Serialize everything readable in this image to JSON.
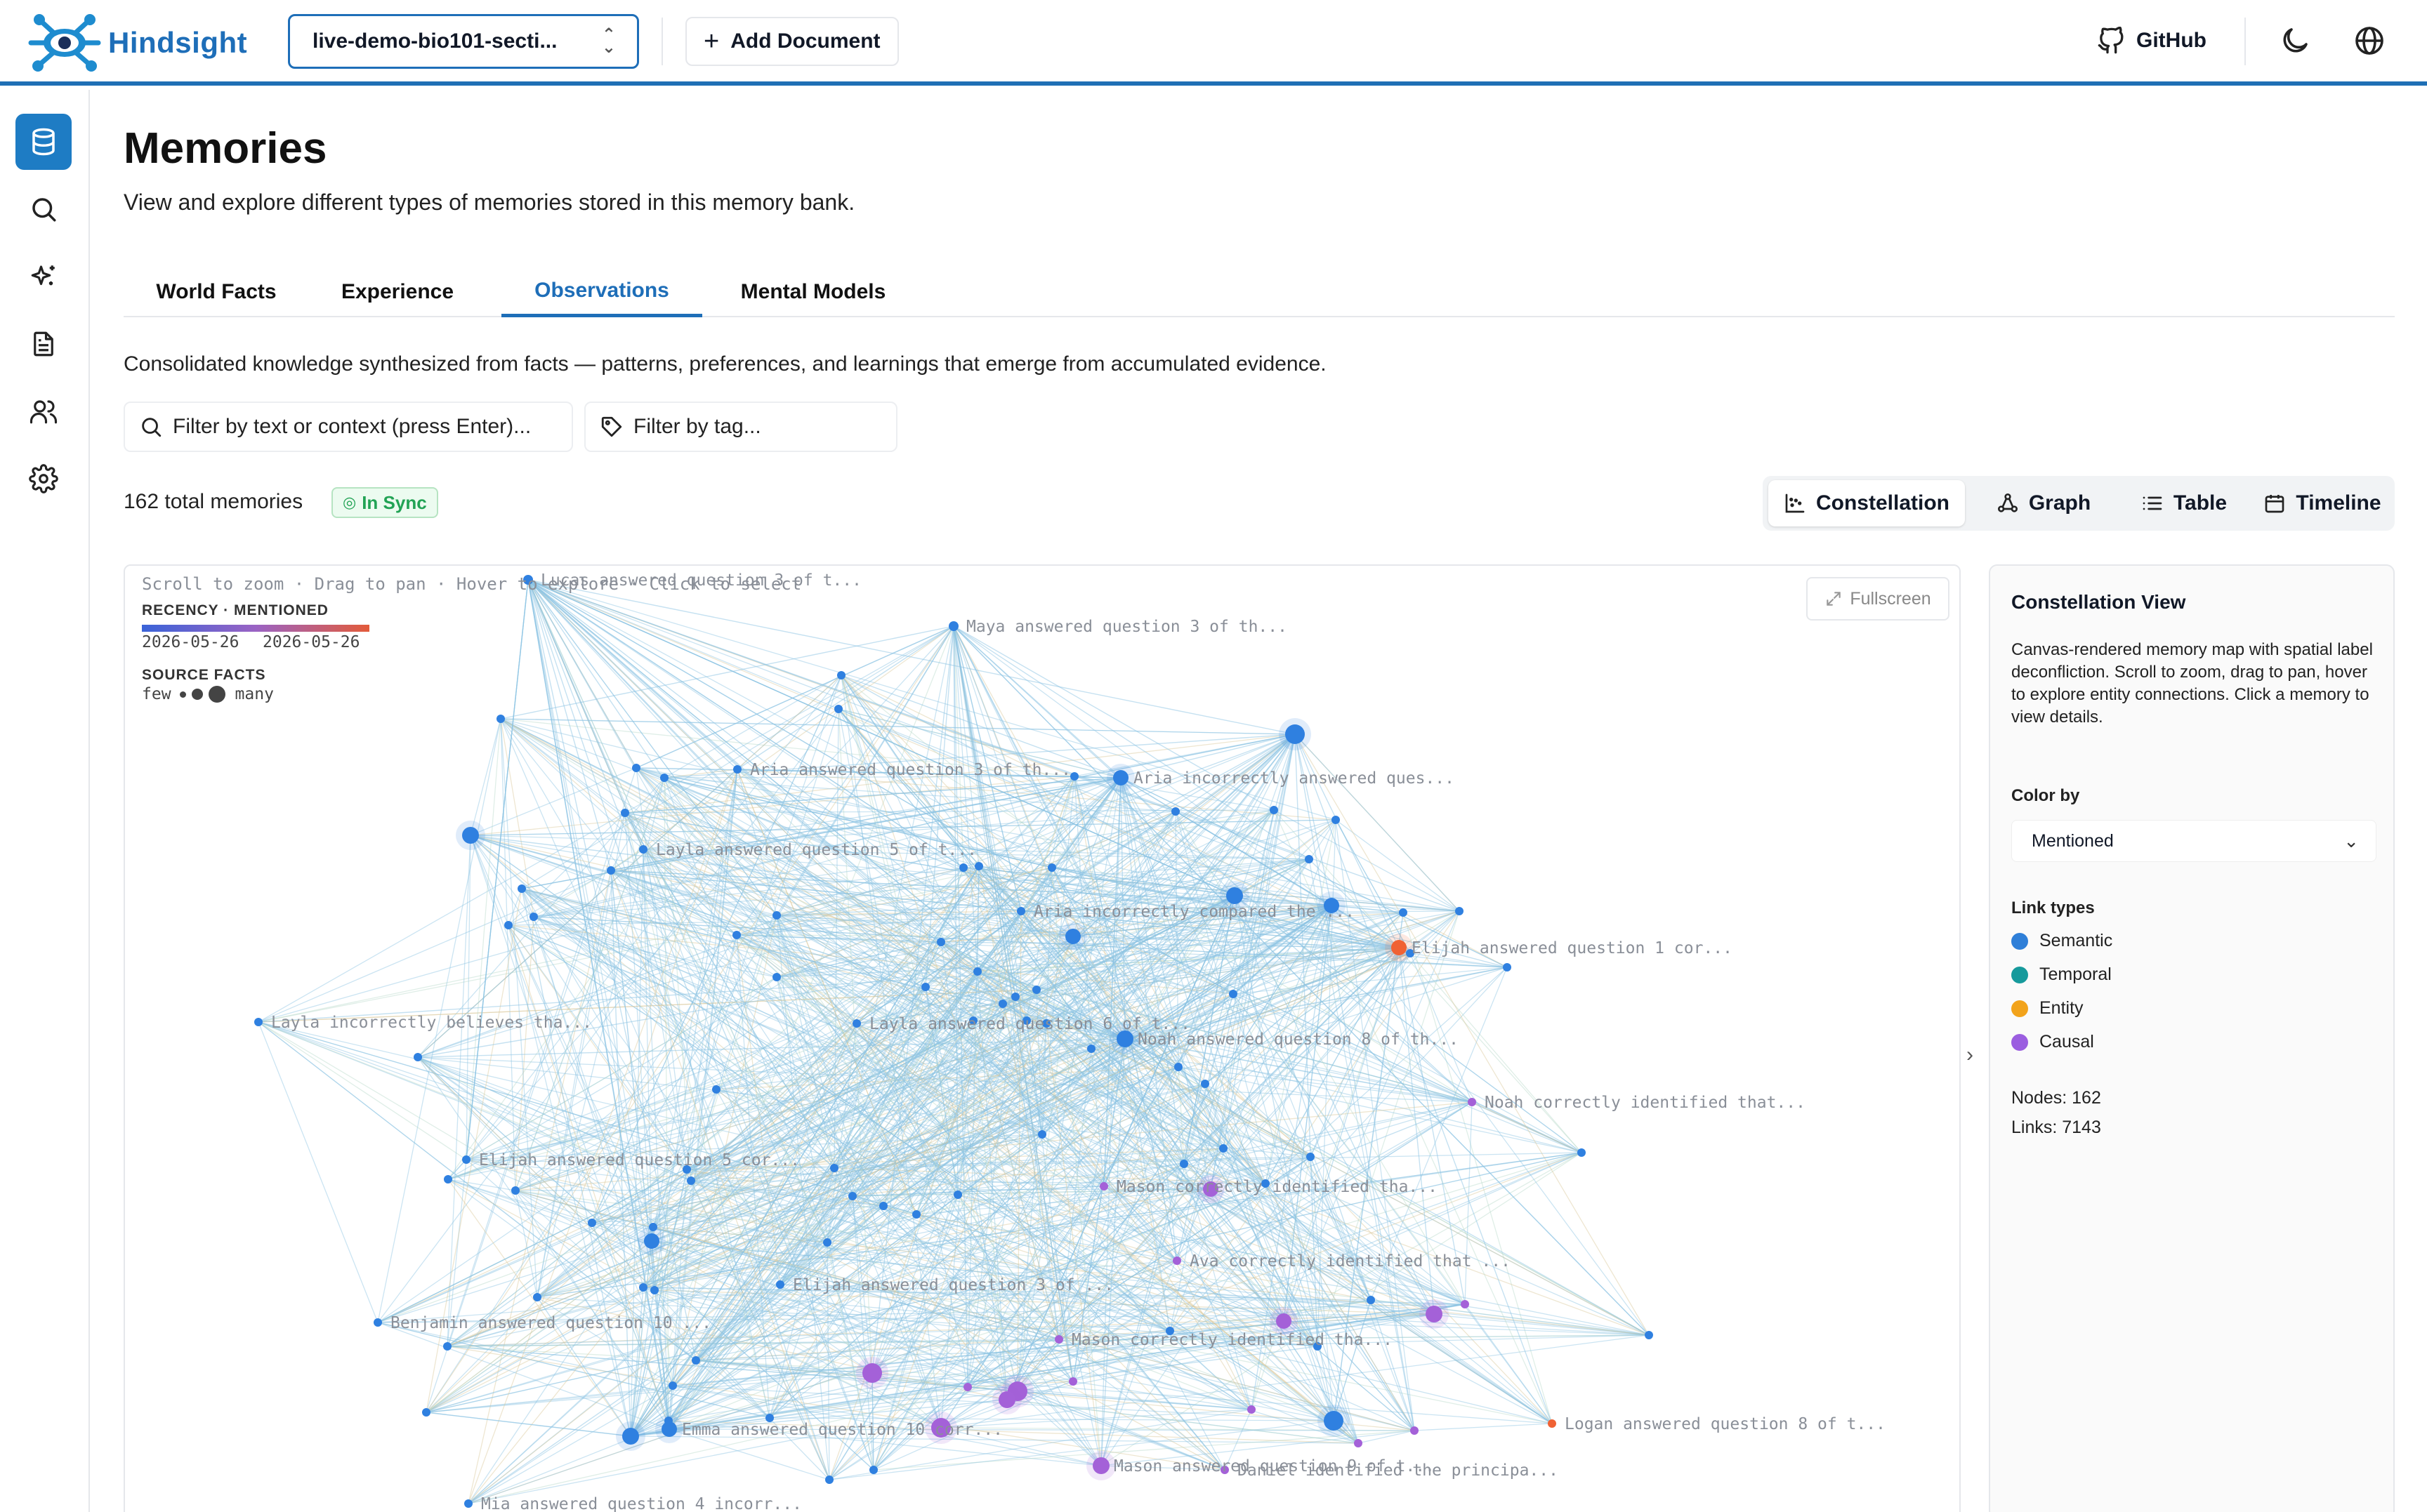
{
  "header": {
    "logo_text": "Hindsight",
    "bank_name": "live-demo-bio101-secti...",
    "add_document_label": "Add Document",
    "github_label": "GitHub"
  },
  "sidebar": {
    "items": [
      {
        "name": "memories",
        "icon": "database-icon",
        "active": true
      },
      {
        "name": "search",
        "icon": "search-icon"
      },
      {
        "name": "reflect",
        "icon": "sparkles-icon"
      },
      {
        "name": "documents",
        "icon": "document-icon"
      },
      {
        "name": "entities",
        "icon": "users-icon"
      },
      {
        "name": "settings",
        "icon": "gear-icon"
      }
    ]
  },
  "page": {
    "title": "Memories",
    "subtitle": "View and explore different types of memories stored in this memory bank.",
    "tabs": [
      "World Facts",
      "Experience",
      "Observations",
      "Mental Models"
    ],
    "active_tab": "Observations",
    "description": "Consolidated knowledge synthesized from facts — patterns, preferences, and learnings that emerge from accumulated evidence.",
    "filter_text_placeholder": "Filter by text or context (press Enter)...",
    "filter_tag_placeholder": "Filter by tag...",
    "total_memories": "162 total memories",
    "sync_status": "In Sync",
    "views": [
      "Constellation",
      "Graph",
      "Table",
      "Timeline"
    ],
    "active_view": "Constellation"
  },
  "canvas": {
    "hint": "Scroll to zoom · Drag to pan · Hover to explore · Click to select",
    "recency_label": "RECENCY · MENTIONED",
    "date_start": "2026-05-26",
    "date_end": "2026-05-26",
    "source_facts_label": "SOURCE FACTS",
    "few_label": "few",
    "many_label": "many",
    "fullscreen_label": "Fullscreen",
    "colors": {
      "semantic": "#2f80e0",
      "purple": "#a461d8",
      "orange": "#f06234",
      "edge": "#7fb6dd"
    },
    "labels": [
      "Lucas answered question 3 of t...",
      "Maya answered question 3 of th...",
      "Aria answered question 3 of th...",
      "Aria incorrectly answered ques...",
      "Layla answered question 5 of t...",
      "Aria incorrectly compared the ...",
      "Elijah answered question 1 cor...",
      "Layla incorrectly believes tha...",
      "Layla answered question 6 of t...",
      "Noah answered question 8 of th...",
      "Noah correctly identified that...",
      "Elijah answered question 5 cor...",
      "Mason correctly identified tha...",
      "Ava correctly identified that ...",
      "Elijah answered question 3 of ...",
      "Benjamin answered question 10 ...",
      "Mason correctly identified tha...",
      "Emma answered question 10 corr...",
      "Logan answered question 8 of t...",
      "Mason answered question 9 of t...",
      "Daniel identified the principa...",
      "Mia answered question 4 incorr..."
    ]
  },
  "panel": {
    "title": "Constellation View",
    "description": "Canvas-rendered memory map with spatial label deconfliction. Scroll to zoom, drag to pan, hover to explore entity connections. Click a memory to view details.",
    "color_by_label": "Color by",
    "color_by_value": "Mentioned",
    "link_types_label": "Link types",
    "link_types": [
      {
        "name": "Semantic",
        "color": "#2f7fd8"
      },
      {
        "name": "Temporal",
        "color": "#169a9c"
      },
      {
        "name": "Entity",
        "color": "#f2a31b"
      },
      {
        "name": "Causal",
        "color": "#9b5ee0"
      }
    ],
    "nodes": "Nodes: 162",
    "links": "Links: 7143"
  }
}
